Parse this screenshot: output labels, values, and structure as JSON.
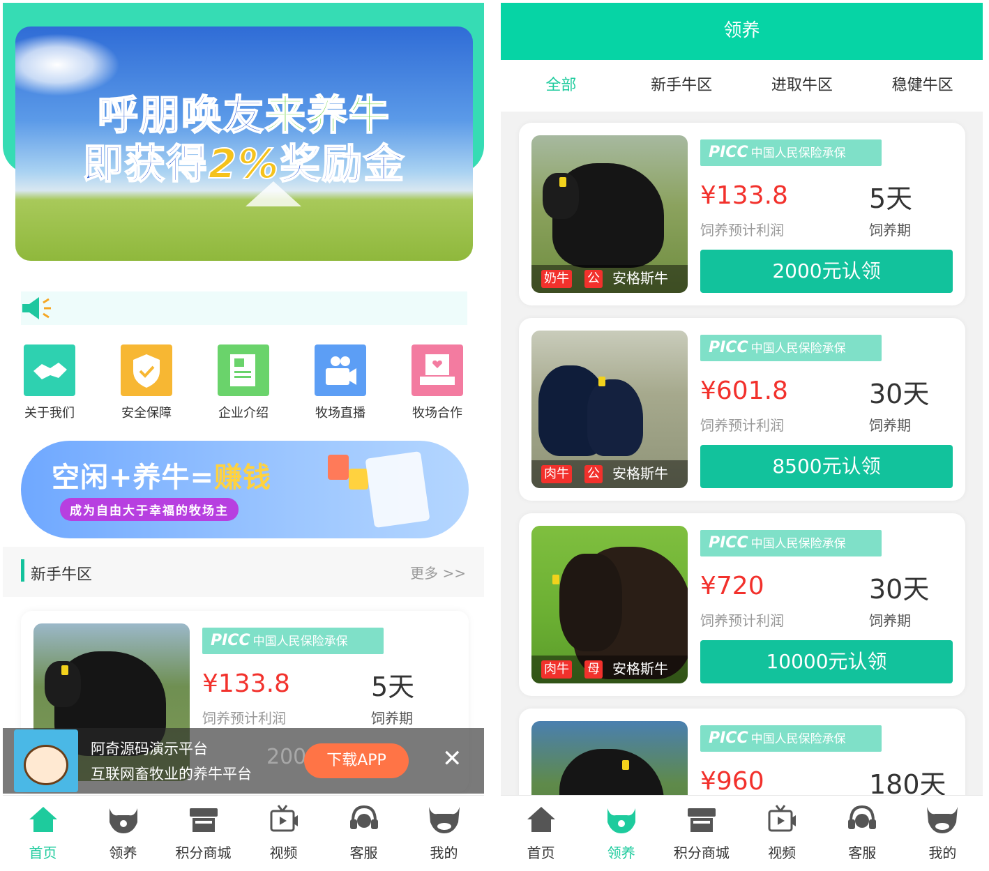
{
  "home": {
    "banner": {
      "line1_blue": "呼朋唤友",
      "line1_green": "来养牛",
      "line2_blue_a": "即获得",
      "line2_gold": "2%",
      "line2_blue_b": "奖励金"
    },
    "quick_links": [
      {
        "label": "关于我们",
        "icon": "handshake-icon",
        "color": "#2ed1b0"
      },
      {
        "label": "安全保障",
        "icon": "shield-icon",
        "color": "#f7b733"
      },
      {
        "label": "企业介绍",
        "icon": "newspaper-icon",
        "color": "#6ad36b"
      },
      {
        "label": "牧场直播",
        "icon": "video-camera-icon",
        "color": "#5c9ef5"
      },
      {
        "label": "牧场合作",
        "icon": "cooperation-icon",
        "color": "#f37ba0"
      }
    ],
    "promo": {
      "slogan_a": "空闲+养牛=",
      "slogan_hl": "赚钱",
      "subtitle": "成为自由大于幸福的牧场主"
    },
    "section": {
      "title": "新手牛区",
      "more": "更多 >>"
    },
    "preview_card": {
      "insurer": "中国人民保险承保",
      "insurer_logo": "PICC",
      "price": "¥133.8",
      "price_label": "饲养预计利润",
      "days": "5天",
      "days_label": "饲养期",
      "hidden_button": "200"
    },
    "popup": {
      "title": "阿奇源码演示平台",
      "subtitle": "互联网畜牧业的养牛平台",
      "download": "下载APP",
      "close": "✕"
    }
  },
  "tabbar": [
    {
      "label": "首页",
      "icon": "home-icon"
    },
    {
      "label": "领养",
      "icon": "cow-head-icon"
    },
    {
      "label": "积分商城",
      "icon": "store-icon"
    },
    {
      "label": "视频",
      "icon": "video-icon"
    },
    {
      "label": "客服",
      "icon": "headset-icon"
    },
    {
      "label": "我的",
      "icon": "bull-icon"
    }
  ],
  "adopt": {
    "title": "领养",
    "tabs": [
      "全部",
      "新手牛区",
      "进取牛区",
      "稳健牛区"
    ],
    "active_tab": "全部",
    "insurer_logo": "PICC",
    "insurer": "中国人民保险承保",
    "price_label": "饲养预计利润",
    "days_label": "饲养期",
    "cards": [
      {
        "type": "奶牛",
        "sex": "公",
        "breed": "安格斯牛",
        "price": "¥133.8",
        "days": "5天",
        "button": "2000元认领"
      },
      {
        "type": "肉牛",
        "sex": "公",
        "breed": "安格斯牛",
        "price": "¥601.8",
        "days": "30天",
        "button": "8500元认领"
      },
      {
        "type": "肉牛",
        "sex": "母",
        "breed": "安格斯牛",
        "price": "¥720",
        "days": "30天",
        "button": "10000元认领"
      },
      {
        "type": "",
        "sex": "",
        "breed": "",
        "price": "¥960",
        "days": "180天",
        "button": ""
      }
    ]
  },
  "colors": {
    "brand": "#06d4a5",
    "accent_red": "#f2312c",
    "active_tab": "#1ecb9d"
  }
}
